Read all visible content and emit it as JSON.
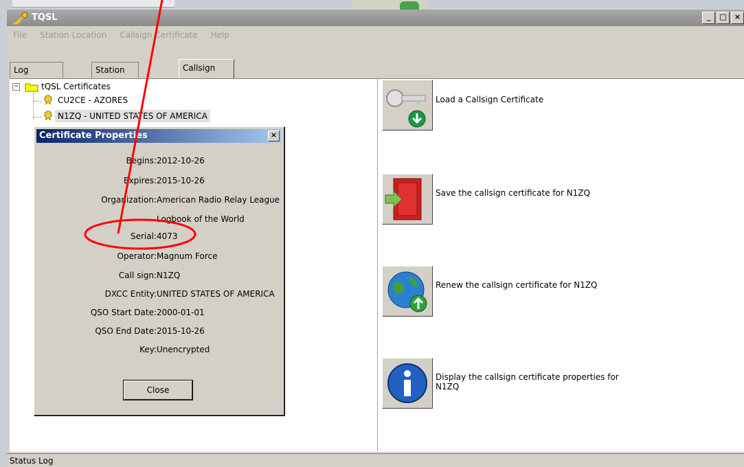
{
  "window": {
    "title": "TQSL"
  },
  "menu": [
    "File",
    "Station Location",
    "Callsign Certificate",
    "Help"
  ],
  "tabs": [
    "Log Operations",
    "Station Locations",
    "Callsign Certificates"
  ],
  "tree": {
    "root": "tQSL Certificates",
    "expander": "−",
    "items": [
      "CU2CE - AZORES",
      "N1ZQ - UNITED STATES OF AMERICA"
    ]
  },
  "actions": [
    {
      "label": "Load a Callsign Certificate",
      "icon": "key-download-icon"
    },
    {
      "label": "Save the callsign certificate for N1ZQ",
      "icon": "save-door-icon"
    },
    {
      "label": "Renew the callsign certificate for N1ZQ",
      "icon": "globe-upload-icon"
    },
    {
      "label": "Display the callsign certificate properties for N1ZQ",
      "icon": "info-icon"
    }
  ],
  "dialog": {
    "title": "Certificate Properties",
    "properties": [
      {
        "key": "Begins:",
        "value": "2012-10-26"
      },
      {
        "key": "Expires:",
        "value": "2015-10-26"
      },
      {
        "key": "Organization:",
        "value": "American Radio Relay League"
      },
      {
        "key": "",
        "value": "Logbook of the World"
      },
      {
        "key": "Serial:",
        "value": "4073"
      },
      {
        "key": "Operator:",
        "value": "Magnum Force"
      },
      {
        "key": "Call sign:",
        "value": "N1ZQ"
      },
      {
        "key": "DXCC Entity:",
        "value": "UNITED STATES OF AMERICA"
      },
      {
        "key": "QSO Start Date:",
        "value": "2000-01-01"
      },
      {
        "key": "QSO End Date:",
        "value": "2015-10-26"
      },
      {
        "key": "Key:",
        "value": "Unencrypted"
      }
    ],
    "close_label": "Close"
  },
  "status": {
    "label": "Status Log"
  },
  "colors": {
    "annotation": "#ff0000",
    "titlebar": "#0a246a",
    "folder": "#ffff00"
  }
}
